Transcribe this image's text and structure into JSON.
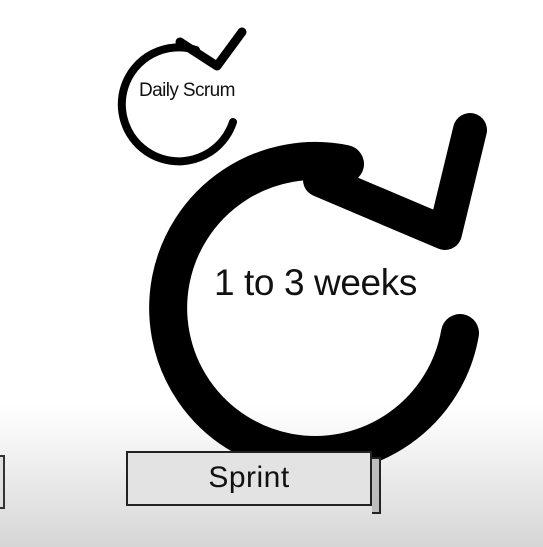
{
  "daily_scrum": {
    "label": "Daily Scrum"
  },
  "sprint_cycle": {
    "label": "1 to 3 weeks"
  },
  "sprint_box": {
    "label": "Sprint"
  },
  "colors": {
    "ink": "#000000",
    "box_fill": "#e3e3e3",
    "floor_shade": "#d6d6d6"
  }
}
